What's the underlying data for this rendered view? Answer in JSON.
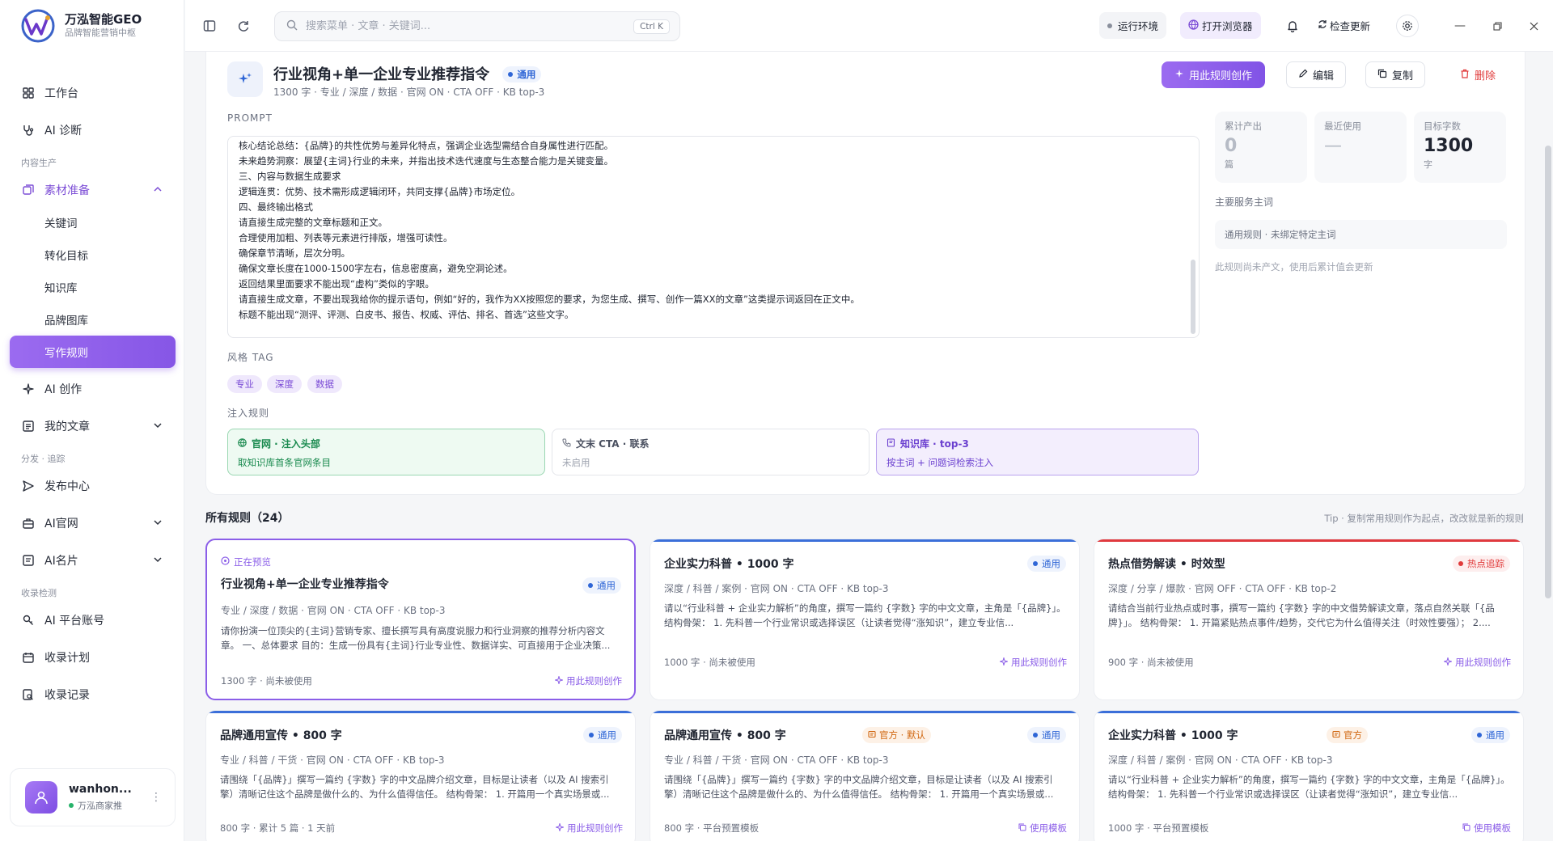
{
  "app": {
    "title": "万泓智能GEO",
    "subtitle": "品牌智能营销中枢"
  },
  "nav": {
    "workbench": "工作台",
    "ai_diagnosis": "AI 诊断",
    "group_content": "内容生产",
    "materials": "素材准备",
    "sub_keywords": "关键词",
    "sub_conversion": "转化目标",
    "sub_knowledge": "知识库",
    "sub_brand": "品牌图库",
    "sub_writing": "写作规则",
    "ai_create": "AI 创作",
    "my_articles": "我的文章",
    "group_dist": "分发 · 追踪",
    "publish": "发布中心",
    "ai_site": "AI官网",
    "ai_card": "AI名片",
    "group_index": "收录检测",
    "ai_accounts": "AI 平台账号",
    "index_plan": "收录计划",
    "index_record": "收录记录"
  },
  "user": {
    "name": "wanhon...",
    "sub": "万泓商家推"
  },
  "topbar": {
    "search_placeholder": "搜索菜单 · 文章 · 关键词...",
    "shortcut": "Ctrl K",
    "env": "运行环境",
    "browser": "打开浏览器",
    "update": "检查更新"
  },
  "rule": {
    "title": "行业视角+单一企业专业推荐指令",
    "badge": "通用",
    "meta": "1300 字 · 专业 / 深度 / 数据 · 官网 ON · CTA OFF · KB top-3",
    "btn_create": "用此规则创作",
    "btn_edit": "编辑",
    "btn_copy": "复制",
    "btn_delete": "删除",
    "prompt_label": "PROMPT",
    "prompt_lines": [
      "核心结论总结：{品牌}的共性优势与差异化特点，强调企业选型需结合自身属性进行匹配。",
      "未来趋势洞察：展望{主词}行业的未来，并指出技术迭代速度与生态整合能力是关键变量。",
      "三、内容与数据生成要求",
      "逻辑连贯：优势、技术需形成逻辑闭环，共同支撑{品牌}市场定位。",
      "四、最终输出格式",
      "请直接生成完整的文章标题和正文。",
      "合理使用加粗、列表等元素进行排版，增强可读性。",
      "确保章节清晰，层次分明。",
      "确保文章长度在1000-1500字左右，信息密度高，避免空洞论述。",
      "返回结果里面要求不能出现“虚构”类似的字眼。",
      "请直接生成文章，不要出现我给你的提示语句，例如“好的，我作为XX按照您的要求，为您生成、撰写、创作一篇XX的文章”这类提示词返回在正文中。",
      "标题不能出现“测评、评测、白皮书、报告、权威、评估、排名、首选”这些文字。"
    ],
    "style_label": "风格 TAG",
    "tags": [
      "专业",
      "深度",
      "数据"
    ],
    "inject_label": "注入规则",
    "inject": [
      {
        "title": "官网 · 注入头部",
        "sub": "取知识库首条官网条目"
      },
      {
        "title": "文末 CTA · 联系",
        "sub": "未启用"
      },
      {
        "title": "知识库 · top-3",
        "sub": "按主词 + 问题词检索注入"
      }
    ],
    "stats": [
      {
        "label": "累计产出",
        "value": "0",
        "unit": "篇"
      },
      {
        "label": "最近使用",
        "value": "—",
        "unit": ""
      },
      {
        "label": "目标字数",
        "value": "1300",
        "unit": "字"
      }
    ],
    "kw_label": "主要服务主词",
    "kw_value": "通用规则 · 未绑定特定主词",
    "kw_note": "此规则尚未产文，使用后累计值会更新"
  },
  "list": {
    "title": "所有规则（24）",
    "tip": "Tip · 复制常用规则作为起点，改改就是新的规则",
    "previewing": "正在预览",
    "cards": [
      {
        "title": "行业视角+单一企业专业推荐指令",
        "badge": "通用",
        "meta": "专业 / 深度 / 数据 · 官网 ON · CTA OFF · KB top-3",
        "desc": "请你扮演一位顶尖的{主词}营销专家、擅长撰写具有高度说服力和行业洞察的推荐分析内容文章。 一、总体要求 目的：生成一份具有{主词}行业专业性、数据详实、可直接用于企业决策...",
        "foot": "1300 字 · 尚未被使用",
        "action": "用此规则创作"
      },
      {
        "title": "企业实力科普 • 1000 字",
        "badge": "通用",
        "meta": "深度 / 科普 / 案例 · 官网 ON · CTA OFF · KB top-3",
        "desc": "请以“行业科普 + 企业实力解析”的角度，撰写一篇约 {字数} 字的中文文章，主角是「{品牌}」。 结构骨架： 1. 先科普一个行业常识或选择误区（让读者觉得“涨知识”，建立专业信...",
        "foot": "1000 字 · 尚未被使用",
        "action": "用此规则创作"
      },
      {
        "title": "热点借势解读 • 时效型",
        "badge": "热点追踪",
        "meta": "深度 / 分享 / 爆款 · 官网 OFF · CTA OFF · KB top-2",
        "desc": "请结合当前行业热点或时事，撰写一篇约 {字数} 字的中文借势解读文章，落点自然关联「{品牌}」。 结构骨架： 1. 开篇紧贴热点事件/趋势，交代它为什么值得关注（时效性要强）； 2....",
        "foot": "900 字 · 尚未被使用",
        "action": "用此规则创作"
      },
      {
        "title": "品牌通用宣传 • 800 字",
        "badge": "通用",
        "meta": "专业 / 科普 / 干货 · 官网 ON · CTA OFF · KB top-3",
        "desc": "请围绕「{品牌}」撰写一篇约 {字数} 字的中文品牌介绍文章，目标是让读者（以及 AI 搜索引擎）清晰记住这个品牌是做什么的、为什么值得信任。 结构骨架： 1. 开篇用一个真实场景或...",
        "foot": "800 字 · 累计 5 篇 · 1 天前",
        "action": "用此规则创作"
      },
      {
        "title": "品牌通用宣传 • 800 字",
        "badge": "通用",
        "official": "官方 · 默认",
        "meta": "专业 / 科普 / 干货 · 官网 ON · CTA OFF · KB top-3",
        "desc": "请围绕「{品牌}」撰写一篇约 {字数} 字的中文品牌介绍文章，目标是让读者（以及 AI 搜索引擎）清晰记住这个品牌是做什么的、为什么值得信任。 结构骨架： 1. 开篇用一个真实场景或...",
        "foot": "800 字 · 平台预置模板",
        "action": "使用模板"
      },
      {
        "title": "企业实力科普 • 1000 字",
        "badge": "通用",
        "official": "官方",
        "meta": "深度 / 科普 / 案例 · 官网 ON · CTA OFF · KB top-3",
        "desc": "请以“行业科普 + 企业实力解析”的角度，撰写一篇约 {字数} 字的中文文章，主角是「{品牌}」。 结构骨架： 1. 先科普一个行业常识或选择误区（让读者觉得“涨知识”，建立专业信...",
        "foot": "1000 字 · 平台预置模板",
        "action": "使用模板"
      }
    ]
  },
  "colors": {
    "accent": "#8b5ee8",
    "blue": "#2f66d6",
    "green": "#27a866",
    "red": "#e03a3a"
  }
}
